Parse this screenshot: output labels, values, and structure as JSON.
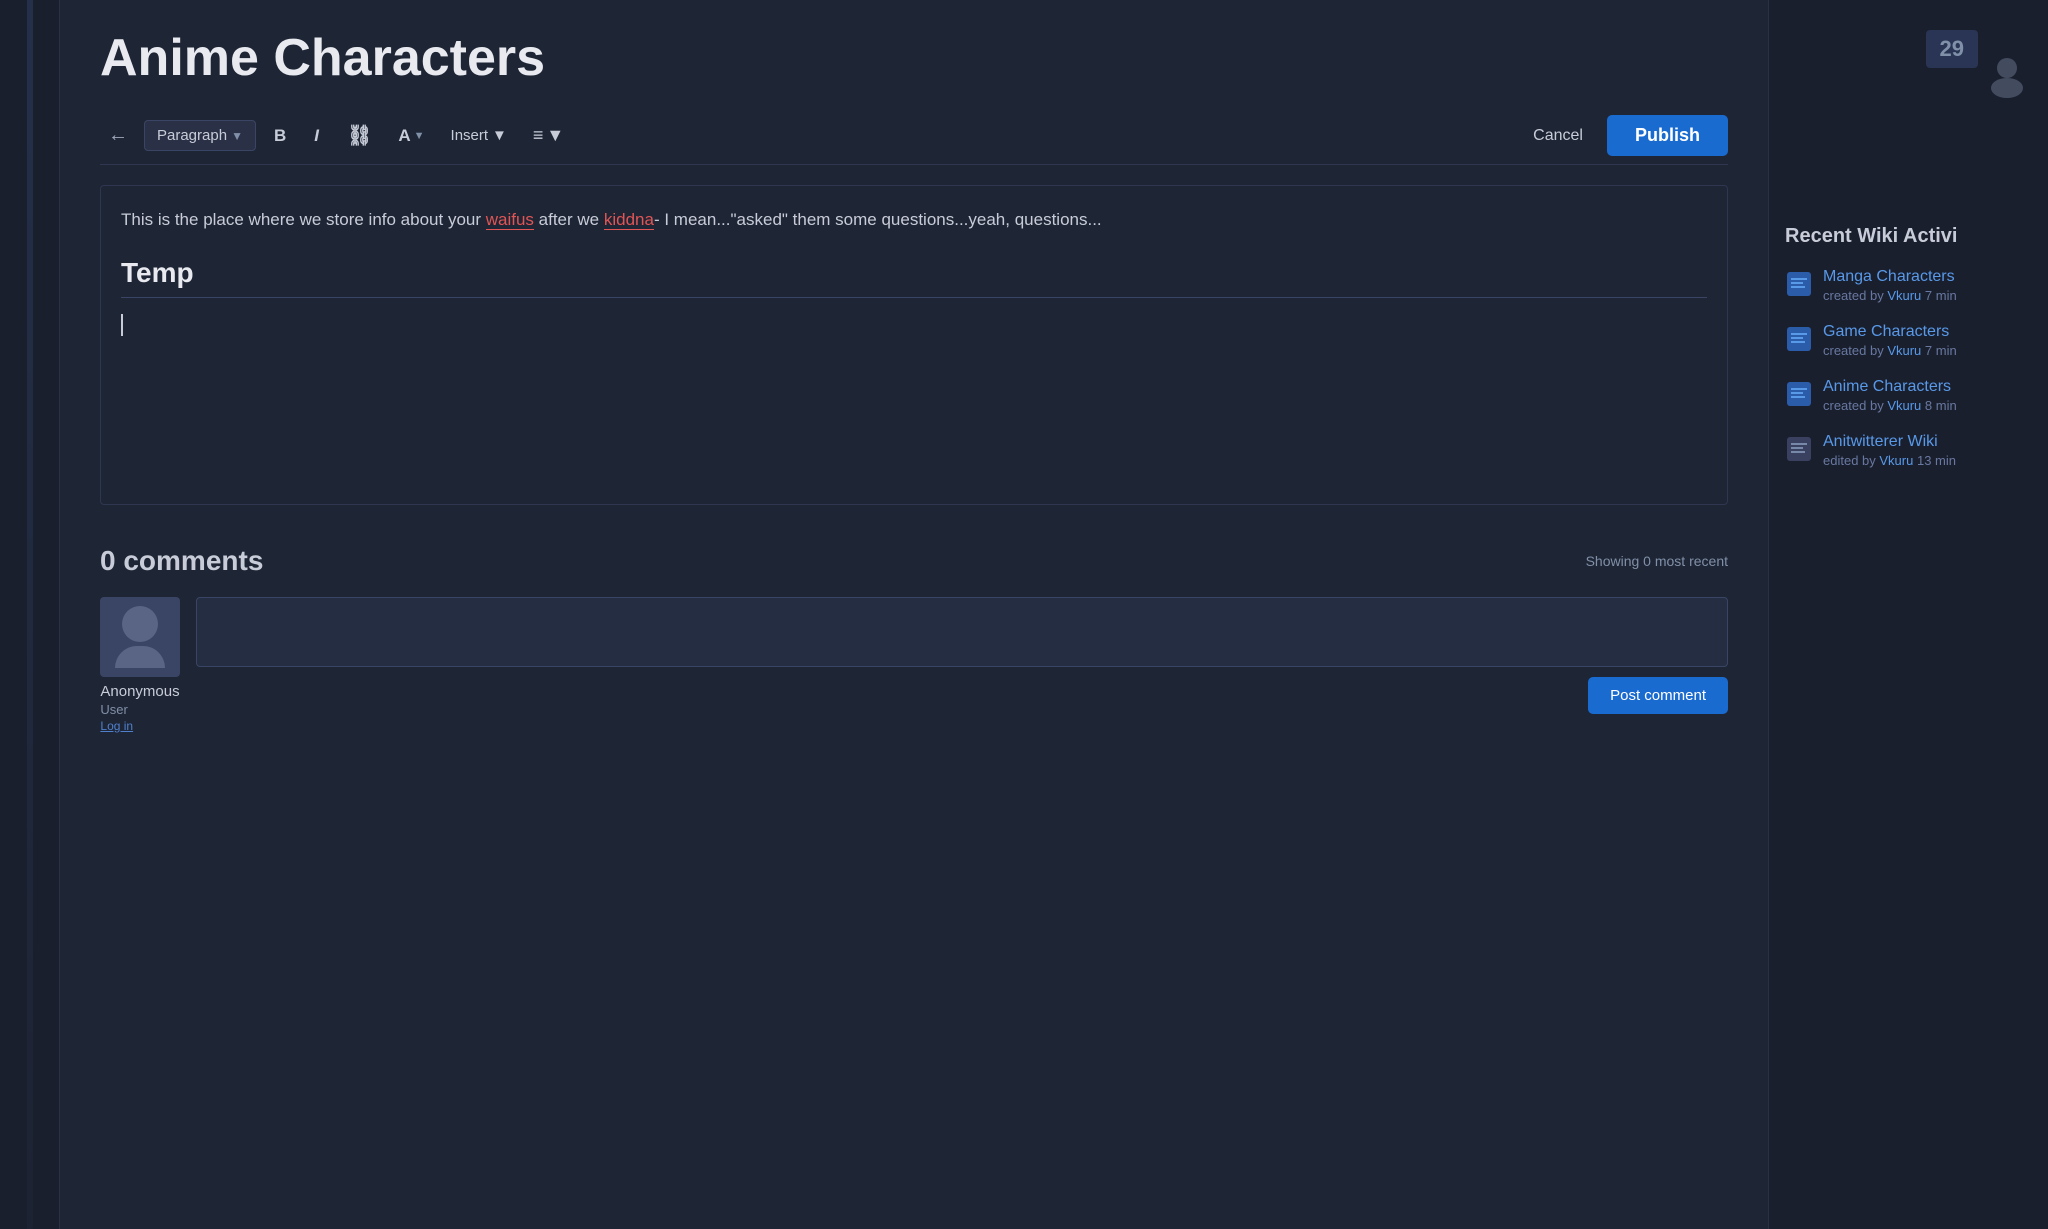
{
  "page": {
    "title": "Anime Characters"
  },
  "toolbar": {
    "back_label": "←",
    "paragraph_label": "Paragraph",
    "bold_label": "B",
    "italic_label": "I",
    "link_label": "⛓",
    "font_color_label": "A",
    "insert_label": "Insert",
    "align_label": "≡",
    "cancel_label": "Cancel",
    "publish_label": "Publish"
  },
  "editor": {
    "description_plain": "This is the place where we store info about your waifus after we kiddna- I mean...\"asked\" them some questions...yeah, questions...",
    "description_part1": "This is the place where we store info about your ",
    "waifus_text": "waifus",
    "description_part2": " after we ",
    "kiddna_text": "kiddna",
    "description_part3": "- I mean...\"asked\" them some questions...yeah, questions...",
    "heading": "Temp",
    "word_count": "29"
  },
  "comments": {
    "title": "0 comments",
    "showing_text": "Showing 0 most recent",
    "commenter": {
      "name": "Anonymous",
      "role": "User",
      "link_text": "Log in"
    },
    "post_button": "Post comment"
  },
  "sidebar": {
    "title": "Recent Wiki Activi",
    "activities": [
      {
        "name": "Manga Characters",
        "action": "created by",
        "username": "Vkuru",
        "time": "7 min"
      },
      {
        "name": "Game Characters",
        "action": "created by",
        "username": "Vkuru",
        "time": "7 min"
      },
      {
        "name": "Anime Characters",
        "action": "created by",
        "username": "Vkuru",
        "time": "8 min"
      },
      {
        "name": "Anitwitterer Wiki",
        "action": "edited by",
        "username": "Vkuru",
        "time": "13 min"
      }
    ]
  }
}
